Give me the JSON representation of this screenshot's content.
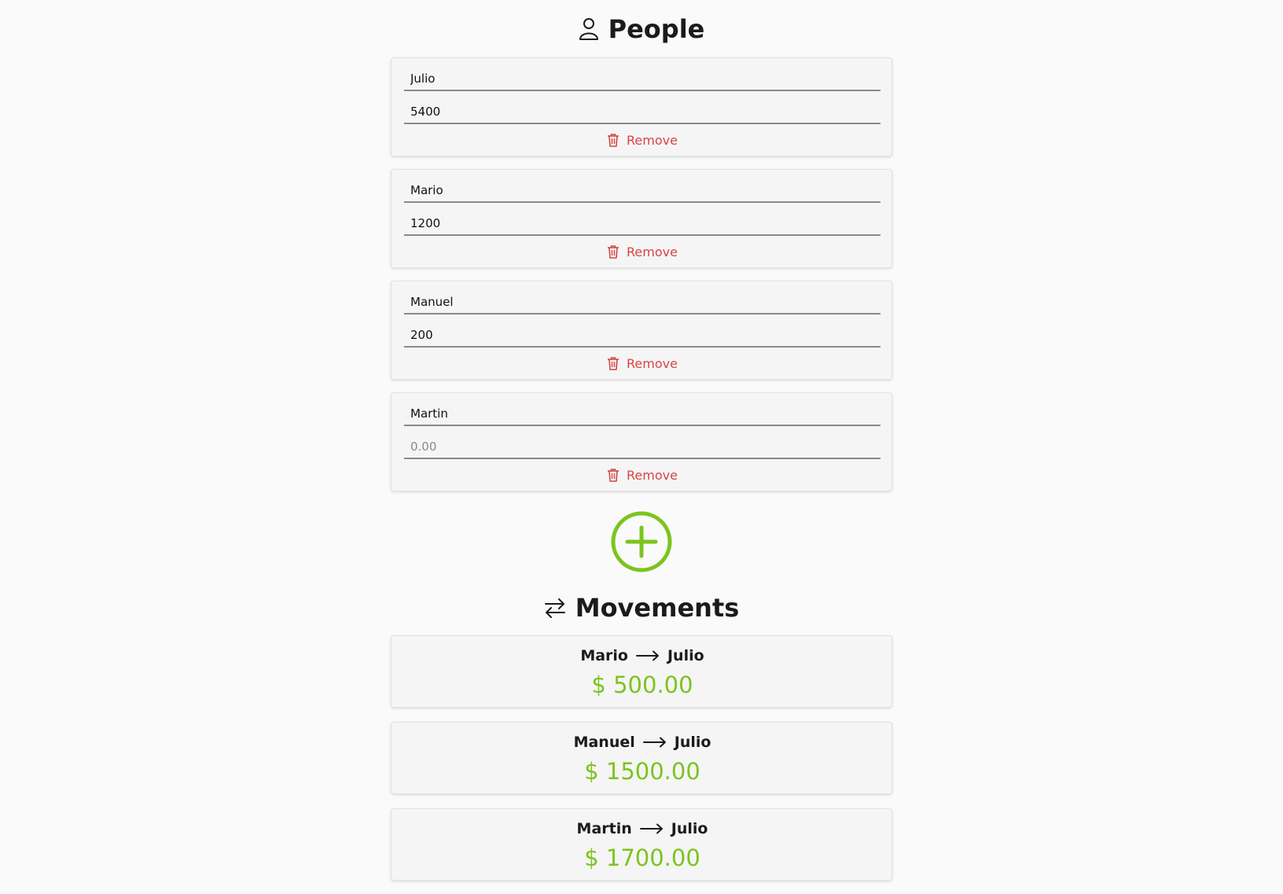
{
  "people_section": {
    "title": "People",
    "icon": "person-icon"
  },
  "people": [
    {
      "name": "Julio",
      "amount": "5400",
      "amount_placeholder": "0.00",
      "remove_label": "Remove"
    },
    {
      "name": "Mario",
      "amount": "1200",
      "amount_placeholder": "0.00",
      "remove_label": "Remove"
    },
    {
      "name": "Manuel",
      "amount": "200",
      "amount_placeholder": "0.00",
      "remove_label": "Remove"
    },
    {
      "name": "Martin",
      "amount": "",
      "amount_placeholder": "0.00",
      "remove_label": "Remove"
    }
  ],
  "add_button": {
    "icon": "plus-circle-icon",
    "color": "#7cc41f"
  },
  "movements_section": {
    "title": "Movements",
    "icon": "swap-arrows-icon"
  },
  "movements": [
    {
      "from": "Mario",
      "to": "Julio",
      "amount": "$ 500.00"
    },
    {
      "from": "Manuel",
      "to": "Julio",
      "amount": "$ 1500.00"
    },
    {
      "from": "Martin",
      "to": "Julio",
      "amount": "$ 1700.00"
    }
  ],
  "colors": {
    "accent": "#7cc41f",
    "danger": "#d64545",
    "card_bg": "#f5f5f5",
    "page_bg": "#fafafa"
  }
}
